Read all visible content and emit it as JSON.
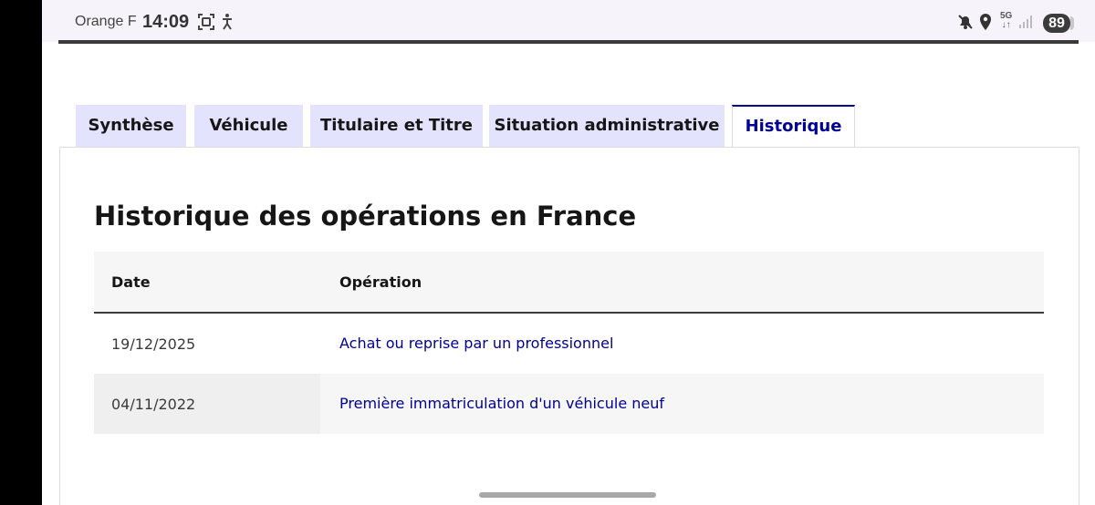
{
  "status_bar": {
    "carrier": "Orange F",
    "time": "14:09",
    "network": "5G",
    "battery": "89",
    "icons": [
      "screenshot-icon",
      "accessibility-icon",
      "mute-icon",
      "location-icon",
      "network-5g-icon",
      "signal-icon",
      "battery-icon"
    ]
  },
  "tabs": [
    {
      "label": "Synthèse",
      "active": false
    },
    {
      "label": "Véhicule",
      "active": false
    },
    {
      "label": "Titulaire et Titre",
      "active": false
    },
    {
      "label": "Situation administrative",
      "active": false
    },
    {
      "label": "Historique",
      "active": true
    }
  ],
  "panel": {
    "title": "Historique des opérations en France",
    "table": {
      "headers": {
        "date": "Date",
        "operation": "Opération"
      },
      "rows": [
        {
          "date": "19/12/2025",
          "operation": "Achat ou reprise par un professionnel"
        },
        {
          "date": "04/11/2022",
          "operation": "Première immatriculation d'un véhicule neuf"
        }
      ]
    }
  },
  "colors": {
    "accent": "#000091",
    "tab_bg": "#e3e3fd",
    "header_bg": "#f6f6f6"
  }
}
